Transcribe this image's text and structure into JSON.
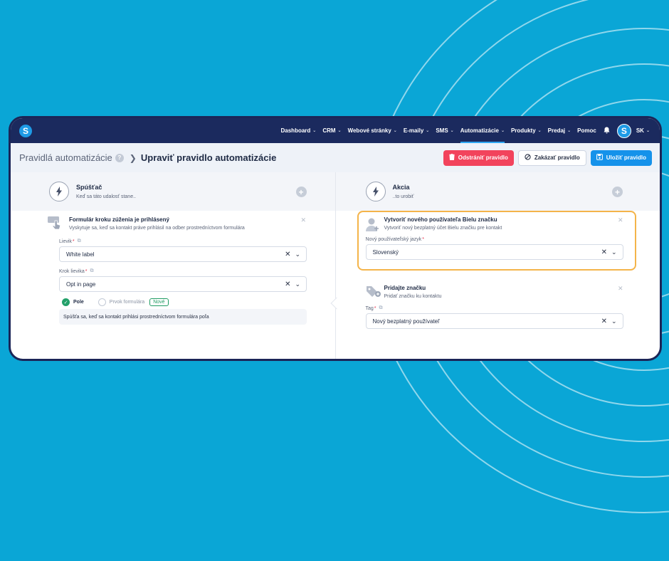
{
  "brand": {
    "logo_letter": "S",
    "accent": "#1592ea",
    "nav_bg": "#1b2a5e",
    "bg": "#0aa6d6"
  },
  "nav": {
    "items": [
      {
        "label": "Dashboard",
        "active": false
      },
      {
        "label": "CRM",
        "active": false
      },
      {
        "label": "Webové stránky",
        "active": false
      },
      {
        "label": "E-maily",
        "active": false
      },
      {
        "label": "SMS",
        "active": false
      },
      {
        "label": "Automatizácie",
        "active": true
      },
      {
        "label": "Produkty",
        "active": false
      },
      {
        "label": "Predaj",
        "active": false
      },
      {
        "label": "Pomoc",
        "active": false
      }
    ],
    "avatar_letter": "S",
    "language": "SK"
  },
  "header": {
    "breadcrumb_root": "Pravidlá automatizácie",
    "help_glyph": "?",
    "breadcrumb_current": "Upraviť pravidlo automatizácie",
    "delete_label": "Odstrániť pravidlo",
    "disable_label": "Zakázať pravidlo",
    "save_label": "Uložiť pravidlo"
  },
  "trigger": {
    "title": "Spúšťač",
    "subtitle": "Keď sa táto udalosť stane..",
    "card": {
      "title": "Formulár kroku zúženia je prihlásený",
      "desc": "Vyskytuje sa, keď sa kontakt práve prihlásil na odber prostredníctvom formulára",
      "field1_label": "Lievik",
      "field1_value": "White label",
      "field2_label": "Krok lievika",
      "field2_value": "Opt in page",
      "radio_on": "Pole",
      "radio_off": "Prvok formulára",
      "badge": "Nové",
      "hint": "Spúšťa sa, keď sa kontakt prihlási prostredníctvom formulára poľa"
    }
  },
  "action": {
    "title": "Akcia",
    "subtitle": "..to urobiť",
    "card1": {
      "title": "Vytvoriť nového používateľa Bielu značku",
      "desc": "Vytvoriť nový bezplatný účet Bielu značku pre kontakt",
      "field_label": "Nový používateľský jazyk",
      "field_value": "Slovenský"
    },
    "card2": {
      "title": "Pridajte značku",
      "desc": "Pridať značku ku kontaktu",
      "field_label": "Tag",
      "field_value": "Nový bezplatný používateľ"
    },
    "highlight_color": "#f4b44a"
  }
}
